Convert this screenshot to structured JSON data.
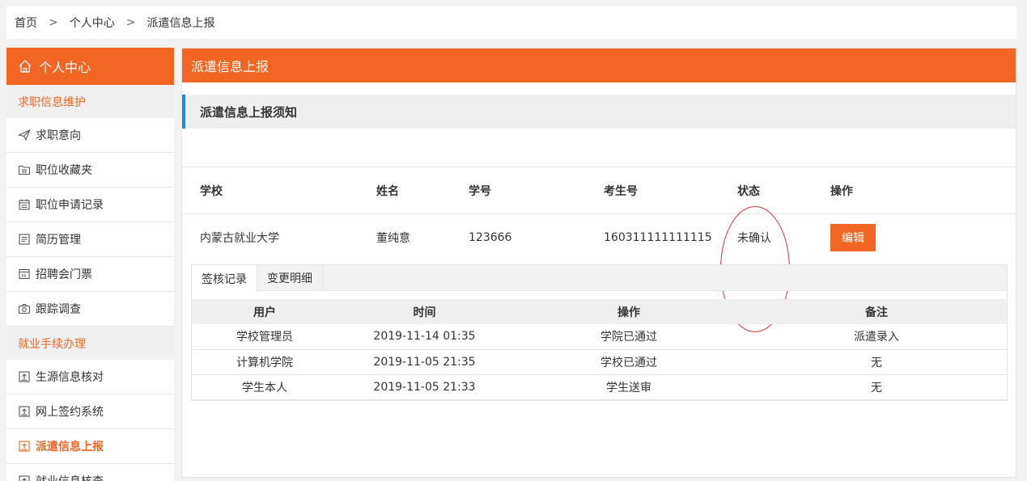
{
  "breadcrumb": [
    "首页",
    "个人中心",
    "派遣信息上报"
  ],
  "sidebar": {
    "title": "个人中心",
    "groups": [
      {
        "label": "求职信息维护",
        "items": [
          {
            "label": "求职意向",
            "icon": "paper-plane-icon"
          },
          {
            "label": "职位收藏夹",
            "icon": "folder-icon"
          },
          {
            "label": "职位申请记录",
            "icon": "calendar-icon"
          },
          {
            "label": "简历管理",
            "icon": "document-icon"
          },
          {
            "label": "招聘会门票",
            "icon": "ticket-icon"
          },
          {
            "label": "跟踪调查",
            "icon": "camera-icon"
          }
        ]
      },
      {
        "label": "就业手续办理",
        "items": [
          {
            "label": "生源信息核对",
            "icon": "upload-box-icon"
          },
          {
            "label": "网上签约系统",
            "icon": "upload-box-icon"
          },
          {
            "label": "派遣信息上报",
            "icon": "upload-box-icon",
            "active": true
          },
          {
            "label": "就业信息核查",
            "icon": "upload-box-icon"
          }
        ]
      }
    ]
  },
  "main": {
    "title": "派遣信息上报",
    "notice_title": "派遣信息上报须知",
    "table": {
      "headers": [
        "学校",
        "姓名",
        "学号",
        "考生号",
        "状态",
        "操作"
      ],
      "row": {
        "school": "内蒙古就业大学",
        "name": "董纯意",
        "student_id": "123666",
        "exam_id": "160311111111115",
        "status": "未确认",
        "action": "编辑"
      }
    },
    "tabs": [
      "签核记录",
      "变更明细"
    ],
    "log": {
      "headers": [
        "用户",
        "时间",
        "操作",
        "备注"
      ],
      "rows": [
        [
          "学校管理员",
          "2019-11-14 01:35",
          "学院已通过",
          "派遣录入"
        ],
        [
          "计算机学院",
          "2019-11-05 21:35",
          "学校已通过",
          "无"
        ],
        [
          "学生本人",
          "2019-11-05 21:33",
          "学生送审",
          "无"
        ]
      ]
    }
  },
  "colors": {
    "accent": "#f26522",
    "notice_bar": "#1e88e5",
    "annotation": "#d9303a"
  }
}
